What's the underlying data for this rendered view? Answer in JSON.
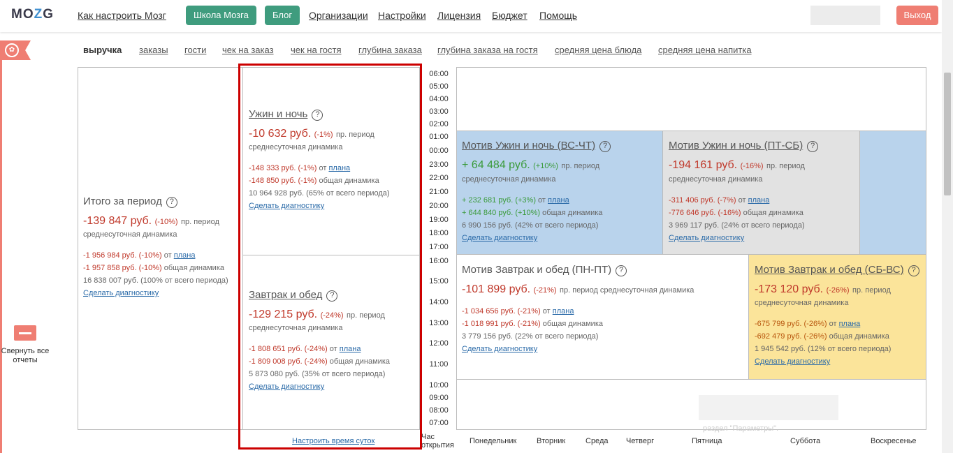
{
  "header": {
    "logo": "MOZG",
    "nav": {
      "how_to": "Как настроить Мозг",
      "school": "Школа Мозга",
      "blog": "Блог",
      "orgs": "Организации",
      "settings": "Настройки",
      "license": "Лицензия",
      "budget": "Бюджет",
      "help": "Помощь"
    },
    "exit": "Выход"
  },
  "sidebar": {
    "collapse_label": "Свернуть все отчеты"
  },
  "tabs": [
    "выручка",
    "заказы",
    "гости",
    "чек на заказ",
    "чек на гостя",
    "глубина заказа",
    "глубина заказа на гостя",
    "средняя цена блюда",
    "средняя цена напитка"
  ],
  "total": {
    "title": "Итого за период",
    "value": "-139 847 руб.",
    "pct": "(-10%)",
    "desc1": "пр. период",
    "desc2": "среднесуточная динамика",
    "line1_val": "-1 956 984 руб. (-10%)",
    "line1_txt": "от",
    "line1_link": "плана",
    "line2_val": "-1 957 858 руб. (-10%)",
    "line2_txt": "общая динамика",
    "line3": "16 838 007 руб. (100% от всего периода)",
    "diag": "Сделать диагностику"
  },
  "dinner": {
    "title": "Ужин и ночь",
    "value": "-10 632 руб.",
    "pct": "(-1%)",
    "desc1": "пр. период",
    "desc2": "среднесуточная динамика",
    "line1_val": "-148 333 руб. (-1%)",
    "line1_txt": "от",
    "line1_link": "плана",
    "line2_val": "-148 850 руб. (-1%)",
    "line2_txt": "общая динамика",
    "line3": "10 964 928 руб. (65% от всего периода)",
    "diag": "Сделать диагностику"
  },
  "breakfast": {
    "title": "Завтрак и обед",
    "value": "-129 215 руб.",
    "pct": "(-24%)",
    "desc1": "пр. период",
    "desc2": "среднесуточная динамика",
    "line1_val": "-1 808 651 руб. (-24%)",
    "line1_txt": "от",
    "line1_link": "плана",
    "line2_val": "-1 809 008 руб. (-24%)",
    "line2_txt": "общая динамика",
    "line3": "5 873 080 руб. (35% от всего периода)",
    "diag": "Сделать диагностику"
  },
  "configure_time": "Настроить время суток",
  "hours_label": "Час открытия",
  "hours": [
    "06:00",
    "05:00",
    "04:00",
    "03:00",
    "02:00",
    "01:00",
    "00:00",
    "23:00",
    "22:00",
    "21:00",
    "20:00",
    "19:00",
    "18:00",
    "17:00",
    "16:00",
    "15:00",
    "14:00",
    "13:00",
    "12:00",
    "11:00",
    "10:00",
    "09:00",
    "08:00",
    "07:00"
  ],
  "days": [
    "Понедельник",
    "Вторник",
    "Среда",
    "Четверг",
    "Пятница",
    "Суббота",
    "Воскресенье"
  ],
  "motiv_dinner_wd": {
    "title": "Мотив Ужин и ночь (ВС-ЧТ)",
    "value": "+ 64 484 руб.",
    "pct": "(+10%)",
    "desc": "пр. период среднесуточная динамика",
    "line1_val": "+ 232 681 руб. (+3%)",
    "line1_txt": "от",
    "line1_link": "плана",
    "line2_val": "+ 644 840 руб. (+10%)",
    "line2_txt": "общая динамика",
    "line3": "6 990 156 руб. (42% от всего периода)",
    "diag": "Сделать диагностику",
    "color": "#b9d3ec"
  },
  "motiv_dinner_we": {
    "title": "Мотив Ужин и ночь (ПТ-СБ)",
    "value": "-194 161 руб.",
    "pct": "(-16%)",
    "desc": "пр. период среднесуточная динамика",
    "line1_val": "-311 406 руб. (-7%)",
    "line1_txt": "от",
    "line1_link": "плана",
    "line2_val": "-776 646 руб. (-16%)",
    "line2_txt": "общая динамика",
    "line3": "3 969 117 руб. (24% от всего периода)",
    "diag": "Сделать диагностику",
    "color": "#e2e2e2"
  },
  "motiv_breakfast_wd": {
    "title": "Мотив Завтрак и обед (ПН-ПТ)",
    "value": "-101 899 руб.",
    "pct": "(-21%)",
    "desc": "пр. период среднесуточная динамика",
    "line1_val": "-1 034 656 руб. (-21%)",
    "line1_txt": "от",
    "line1_link": "плана",
    "line2_val": "-1 018 991 руб. (-21%)",
    "line2_txt": "общая динамика",
    "line3": "3 779 156 руб. (22% от всего периода)",
    "diag": "Сделать диагностику",
    "color": "#ffffff"
  },
  "motiv_breakfast_we": {
    "title": "Мотив Завтрак и обед (СБ-ВС)",
    "value": "-173 120 руб.",
    "pct": "(-26%)",
    "desc1": "пр. период",
    "desc2": "среднесуточная динамика",
    "line1_val": "-675 799 руб. (-26%)",
    "line1_txt": "от",
    "line1_link": "плана",
    "line2_val": "-692 479 руб. (-26%)",
    "line2_txt": "общая динамика",
    "line3": "1 945 542 руб. (12% от всего периода)",
    "diag": "Сделать диагностику",
    "color": "#fbe49a"
  },
  "blurred_hint": "раздел \"Параметры\"."
}
